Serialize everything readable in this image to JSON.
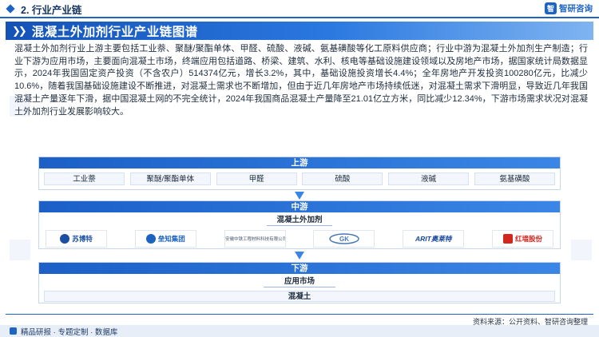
{
  "header": {
    "section_label": "2. 行业产业链",
    "brand_name": "智研咨询",
    "brand_logo_text": "智"
  },
  "title": "混凝土外加剂行业产业链图谱",
  "paragraph": "混凝土外加剂行业上游主要包括工业萘、聚醚/聚酯单体、甲醛、硫酸、液碱、氨基磺酸等化工原料供应商；行业中游为混凝土外加剂生产制造；行业下游为应用市场，主要面向混凝土市场，终端应用包括道路、桥梁、建筑、水利、核电等基础设施建设领域以及房地产市场，据国家统计局数据显示，2024年我国固定资产投资（不含农户）514374亿元，增长3.2%，其中，基础设施投资增长4.4%；全年房地产开发投资100280亿元，比减少10.6%，随着我国基础设施建设不断推进，对混凝土需求也不断增加，但由于近几年房地产市场持续低迷，对混凝土需求下滑明显，导致近几年我国混凝土产量逐年下滑，据中国混凝土网的不完全统计，2024年我国商品混凝土产量降至21.01亿立方米，同比减少12.34%，下游市场需求状况对混凝土外加剂行业发展影响较大。",
  "upstream": {
    "label": "上游",
    "items": [
      "工业萘",
      "聚醚/聚酯单体",
      "甲醛",
      "硫酸",
      "液碱",
      "氨基磺酸"
    ]
  },
  "midstream": {
    "label": "中游",
    "sublabel": "混凝土外加剂",
    "companies": [
      {
        "text": "苏博特",
        "small": "SOBUTE",
        "color": "#1b4fa3"
      },
      {
        "text": "垒知集团",
        "small": "",
        "color": "#1a63c2"
      },
      {
        "text": "",
        "small": "安徽中铁工程材料科技有限公司",
        "color": "#2a4f8c"
      },
      {
        "text": "",
        "small": "",
        "color": "#4a79b8"
      },
      {
        "text": "ARIT奥莱特",
        "small": "",
        "color": "#17469e"
      },
      {
        "text": "红墙股份",
        "small": "",
        "color": "#d2261f"
      }
    ]
  },
  "downstream": {
    "label": "下游",
    "market": "应用市场",
    "product": "混凝土"
  },
  "footer": {
    "source": "资料来源：公开资料、智研咨询整理",
    "tagline": "精品研报 · 专题定制 · 数据库"
  },
  "colors": {
    "primary": "#1d64c4",
    "dark": "#16355f",
    "red_brand": "#d2261f"
  }
}
